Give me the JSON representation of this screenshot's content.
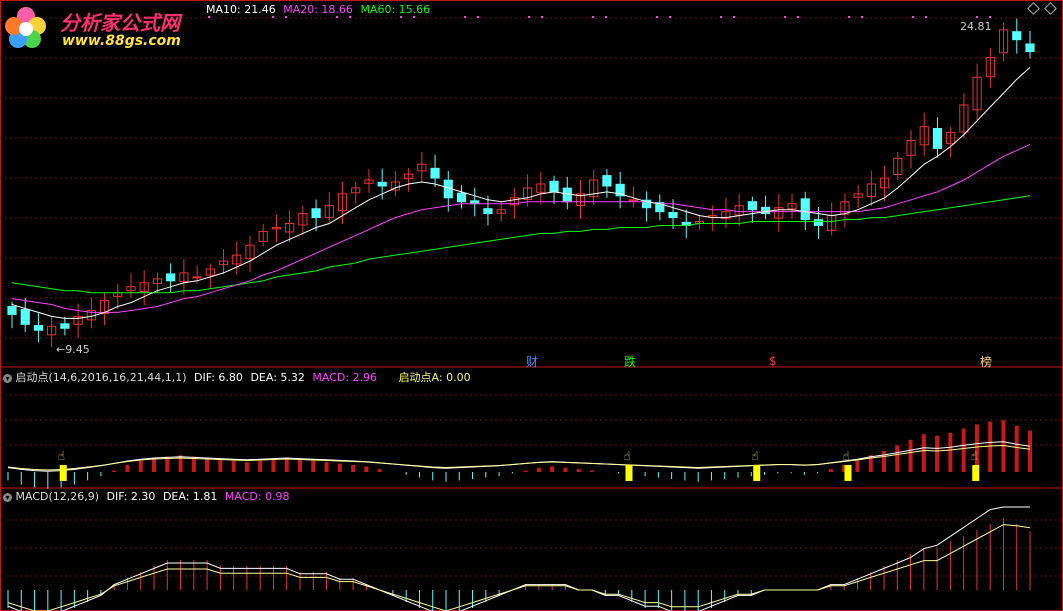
{
  "colors": {
    "background": "#000000",
    "up": "#e8322e",
    "down": "#54ffff",
    "ma10": "#ffffff",
    "ma20": "#ff40ff",
    "ma60": "#00ff00",
    "grid": "#6e1414",
    "separator": "#c01818",
    "marker": "#ffff00"
  },
  "watermark": {
    "title": "分析家公式网",
    "url": "www.88gs.com"
  },
  "main_panel": {
    "ma10_label": "MA10: 21.46",
    "ma20_label": "MA20: 18.66",
    "ma60_label": "MA60: 15.66",
    "high_label": "24.81",
    "low_label": "←9.45",
    "event_labels": [
      {
        "text": "财",
        "color": "#4a8cff"
      },
      {
        "text": "跌",
        "color": "#00ff00"
      },
      {
        "text": "$",
        "color": "#ff3030"
      },
      {
        "text": "榜",
        "color": "#ffd27f"
      }
    ]
  },
  "indicator1": {
    "name": "启动点(14,6,2016,16,21,44,1,1)",
    "dif": "DIF: 6.80",
    "dea": "DEA: 5.32",
    "macd": "MACD: 2.96",
    "signal": "启动点A: 0.00"
  },
  "indicator2": {
    "name": "MACD(12,26,9)",
    "dif": "DIF: 2.30",
    "dea": "DEA: 1.81",
    "macd": "MACD: 0.98"
  },
  "chart_data": {
    "type": "candlestick",
    "price_high": 24.81,
    "price_low": 9.45,
    "close": [
      10.4,
      9.9,
      9.6,
      9.8,
      9.7,
      10.3,
      10.6,
      11.1,
      11.5,
      11.8,
      12.0,
      12.2,
      12.1,
      12.5,
      12.3,
      12.7,
      13.1,
      13.4,
      13.9,
      14.6,
      14.8,
      15.0,
      15.5,
      15.3,
      15.9,
      16.5,
      16.8,
      17.2,
      16.9,
      17.1,
      17.5,
      18.0,
      17.3,
      16.3,
      16.1,
      16.0,
      15.5,
      15.7,
      16.3,
      16.8,
      17.0,
      16.6,
      16.1,
      16.5,
      17.2,
      16.9,
      16.4,
      16.2,
      15.8,
      15.6,
      15.3,
      14.9,
      15.1,
      15.4,
      15.6,
      15.9,
      15.7,
      15.5,
      15.8,
      16.0,
      15.2,
      14.9,
      15.4,
      16.1,
      16.5,
      17.0,
      17.3,
      18.3,
      19.2,
      19.9,
      18.8,
      19.6,
      21.0,
      22.4,
      23.4,
      24.8,
      24.3,
      23.7
    ],
    "ma10": [
      10.9,
      10.7,
      10.5,
      10.3,
      10.2,
      10.2,
      10.3,
      10.5,
      10.8,
      11.0,
      11.3,
      11.6,
      11.8,
      12.0,
      12.1,
      12.3,
      12.5,
      12.8,
      13.1,
      13.5,
      13.9,
      14.2,
      14.5,
      14.8,
      15.0,
      15.4,
      15.8,
      16.2,
      16.5,
      16.8,
      17.0,
      17.1,
      17.0,
      16.8,
      16.6,
      16.4,
      16.2,
      16.1,
      16.2,
      16.3,
      16.5,
      16.6,
      16.5,
      16.4,
      16.5,
      16.6,
      16.5,
      16.3,
      16.1,
      16.0,
      15.8,
      15.6,
      15.4,
      15.3,
      15.3,
      15.4,
      15.5,
      15.6,
      15.7,
      15.7,
      15.6,
      15.5,
      15.4,
      15.5,
      15.7,
      16.0,
      16.3,
      16.8,
      17.4,
      18.0,
      18.4,
      18.9,
      19.5,
      20.2,
      20.9,
      21.6,
      22.3,
      22.9
    ],
    "ma20": [
      11.2,
      11.1,
      11.0,
      10.9,
      10.7,
      10.6,
      10.5,
      10.5,
      10.5,
      10.6,
      10.7,
      10.8,
      11.0,
      11.2,
      11.3,
      11.5,
      11.7,
      11.9,
      12.1,
      12.4,
      12.6,
      12.9,
      13.2,
      13.5,
      13.8,
      14.1,
      14.4,
      14.7,
      15.0,
      15.3,
      15.5,
      15.7,
      15.8,
      15.9,
      16.0,
      16.0,
      16.0,
      16.0,
      16.0,
      16.1,
      16.1,
      16.1,
      16.1,
      16.1,
      16.1,
      16.1,
      16.1,
      16.1,
      16.1,
      16.0,
      16.0,
      15.9,
      15.8,
      15.7,
      15.7,
      15.6,
      15.6,
      15.6,
      15.6,
      15.6,
      15.6,
      15.6,
      15.6,
      15.6,
      15.6,
      15.7,
      15.8,
      16.0,
      16.2,
      16.4,
      16.6,
      16.9,
      17.2,
      17.6,
      18.0,
      18.4,
      18.7,
      19.0
    ],
    "ma60": [
      12.0,
      11.9,
      11.8,
      11.7,
      11.6,
      11.6,
      11.5,
      11.5,
      11.5,
      11.5,
      11.5,
      11.5,
      11.5,
      11.6,
      11.6,
      11.7,
      11.8,
      11.9,
      12.0,
      12.1,
      12.3,
      12.4,
      12.5,
      12.6,
      12.8,
      12.9,
      13.0,
      13.2,
      13.3,
      13.4,
      13.5,
      13.6,
      13.7,
      13.8,
      13.9,
      14.0,
      14.1,
      14.2,
      14.3,
      14.4,
      14.5,
      14.5,
      14.6,
      14.6,
      14.7,
      14.7,
      14.8,
      14.8,
      14.8,
      14.9,
      14.9,
      14.9,
      15.0,
      15.0,
      15.0,
      15.0,
      15.1,
      15.1,
      15.1,
      15.1,
      15.1,
      15.1,
      15.1,
      15.2,
      15.2,
      15.3,
      15.3,
      15.4,
      15.5,
      15.6,
      15.7,
      15.8,
      15.9,
      16.0,
      16.1,
      16.2,
      16.3,
      16.4
    ],
    "ind1_hist": [
      -0.6,
      -0.9,
      -1.1,
      -1.2,
      -1.1,
      -0.9,
      -0.6,
      -0.3,
      0.1,
      0.5,
      0.8,
      1.0,
      1.1,
      1.2,
      1.1,
      1.0,
      0.9,
      0.8,
      0.7,
      0.8,
      0.9,
      1.0,
      0.9,
      0.8,
      0.7,
      0.6,
      0.5,
      0.4,
      0.2,
      0.0,
      -0.2,
      -0.4,
      -0.6,
      -0.7,
      -0.6,
      -0.5,
      -0.4,
      -0.3,
      -0.1,
      0.1,
      0.3,
      0.4,
      0.3,
      0.2,
      0.1,
      0.0,
      -0.1,
      -0.2,
      -0.3,
      -0.4,
      -0.5,
      -0.6,
      -0.7,
      -0.6,
      -0.5,
      -0.4,
      -0.3,
      -0.2,
      -0.1,
      -0.1,
      -0.2,
      -0.1,
      0.2,
      0.5,
      0.8,
      1.2,
      1.5,
      1.9,
      2.3,
      2.7,
      2.6,
      2.8,
      3.1,
      3.4,
      3.6,
      3.7,
      3.3,
      2.96
    ],
    "ind1_signals": [
      6,
      68,
      82,
      92,
      106
    ],
    "macd_hist": [
      -0.3,
      -0.4,
      -0.5,
      -0.5,
      -0.4,
      -0.3,
      -0.2,
      -0.1,
      0.1,
      0.2,
      0.3,
      0.4,
      0.5,
      0.5,
      0.5,
      0.5,
      0.4,
      0.4,
      0.4,
      0.4,
      0.4,
      0.4,
      0.3,
      0.3,
      0.3,
      0.2,
      0.2,
      0.1,
      0.0,
      -0.1,
      -0.2,
      -0.3,
      -0.4,
      -0.5,
      -0.4,
      -0.3,
      -0.2,
      -0.1,
      0.0,
      0.1,
      0.1,
      0.1,
      0.1,
      0.0,
      0.0,
      -0.1,
      -0.1,
      -0.2,
      -0.3,
      -0.3,
      -0.4,
      -0.4,
      -0.4,
      -0.3,
      -0.2,
      -0.1,
      -0.1,
      0.0,
      0.0,
      0.0,
      0.0,
      0.0,
      0.1,
      0.1,
      0.2,
      0.3,
      0.4,
      0.5,
      0.6,
      0.7,
      0.7,
      0.8,
      0.9,
      1.0,
      1.1,
      1.2,
      1.1,
      0.98
    ]
  }
}
